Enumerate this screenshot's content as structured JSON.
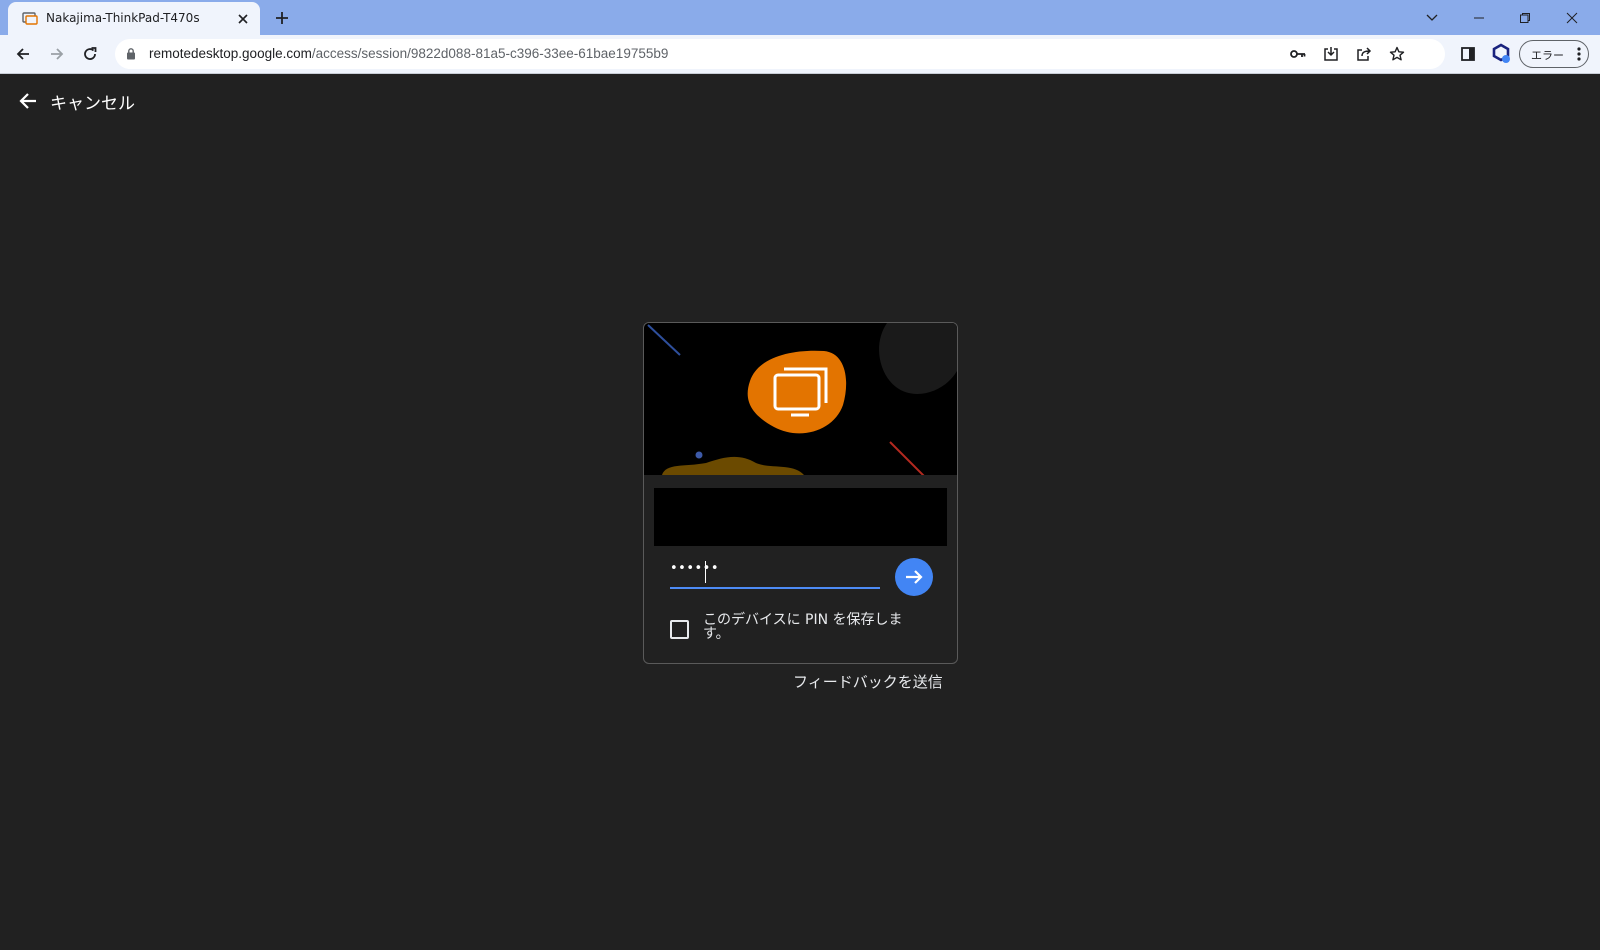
{
  "browser": {
    "tab": {
      "title": "Nakajima-ThinkPad-T470s",
      "favicon": "remote-desktop-favicon-icon"
    },
    "url": {
      "host": "remotedesktop.google.com",
      "path": "/access/session/9822d088-81a5-c396-33ee-61bae19755b9"
    },
    "profile_label": "エラー",
    "colors": {
      "tabstrip": "#8aabea",
      "toolbar": "#f0f4fc"
    }
  },
  "page": {
    "cancel_label": "キャンセル",
    "pin": {
      "value": "••••••",
      "masked": true
    },
    "remember_label": "このデバイスに PIN を保存します。",
    "remember_checked": false,
    "feedback_label": "フィードバックを送信",
    "colors": {
      "background": "#212121",
      "accent": "#4285f4",
      "blob": "#e37400",
      "hero_bg": "#000000"
    }
  }
}
